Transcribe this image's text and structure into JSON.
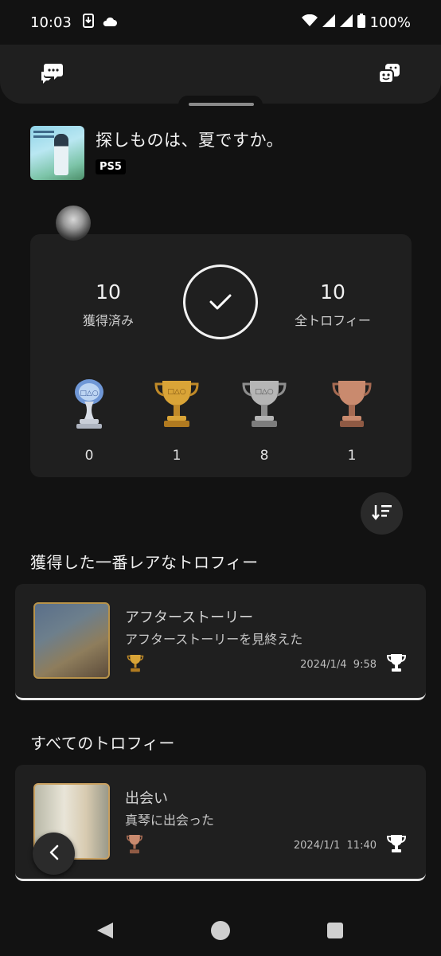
{
  "status_bar": {
    "time": "10:03",
    "battery": "100%"
  },
  "game": {
    "title": "探しものは、夏ですか。",
    "platform": "PS5"
  },
  "summary": {
    "earned_count": "10",
    "earned_label": "獲得済み",
    "total_count": "10",
    "total_label": "全トロフィー",
    "platinum": "0",
    "gold": "1",
    "silver": "8",
    "bronze": "1"
  },
  "sections": {
    "rarest_title": "獲得した一番レアなトロフィー",
    "all_title": "すべてのトロフィー"
  },
  "rarest_trophy": {
    "name": "アフターストーリー",
    "description": "アフターストーリーを見終えた",
    "grade": "gold",
    "date": "2024/1/4",
    "time": "9:58"
  },
  "all_trophies": [
    {
      "name": "出会い",
      "description": "真琴に出会った",
      "grade": "bronze",
      "date": "2024/1/1",
      "time": "11:40"
    }
  ],
  "colors": {
    "background": "#121212",
    "card": "#1f1f1f",
    "gold": "#d9a437",
    "silver": "#b5b5b5",
    "bronze": "#c98a6e",
    "platinum": "#8fb2e0"
  },
  "icons": {
    "top_left": "chat-bubbles-icon",
    "top_right": "game-faces-icon",
    "sort": "sort-descending-icon",
    "back": "chevron-left-icon"
  }
}
